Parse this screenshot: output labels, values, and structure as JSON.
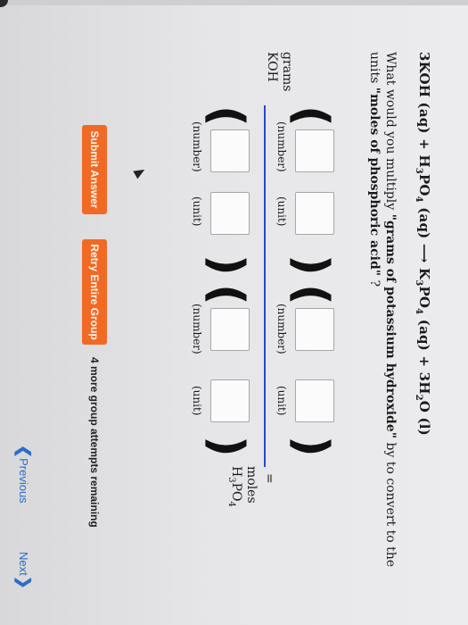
{
  "question": {
    "equation": {
      "left": "3KOH (aq) + H",
      "sub1": "3",
      "mid1": "PO",
      "sub2": "4",
      "mid2": " (aq) ⟶ K",
      "sub3": "3",
      "mid3": "PO",
      "sub4": "4",
      "mid4": " (aq) + 3H",
      "sub5": "2",
      "right": "O (l)"
    },
    "prompt_start": "What would you multiply ",
    "prompt_bold1": "\"grams of potassium hydroxide\"",
    "prompt_mid": " by to convert to the units ",
    "prompt_bold2": "\"moles of phosphoric acid\"",
    "prompt_end": " ?"
  },
  "start_unit": {
    "line1": "grams",
    "line2": "KOH"
  },
  "factor1": {
    "top_number_caption": "(number)",
    "top_unit_caption": "(unit)",
    "bottom_number_caption": "(number)",
    "bottom_unit_caption": "(unit)"
  },
  "factor2": {
    "top_number_caption": "(number)",
    "top_unit_caption": "(unit)",
    "bottom_number_caption": "(number)",
    "bottom_unit_caption": "(unit)"
  },
  "equals": "=",
  "end_unit": {
    "line1": "moles",
    "line2": "H",
    "sub1": "3",
    "mid": "PO",
    "sub2": "4"
  },
  "buttons": {
    "submit": "Submit Answer",
    "retry": "Retry Entire Group"
  },
  "attempts_text": "4 more group attempts remaining",
  "nav": {
    "previous": "Previous",
    "next": "Next"
  },
  "colors": {
    "button": "#f06a25",
    "fraction_bar": "#2b46c9",
    "link": "#2b6cc9"
  }
}
